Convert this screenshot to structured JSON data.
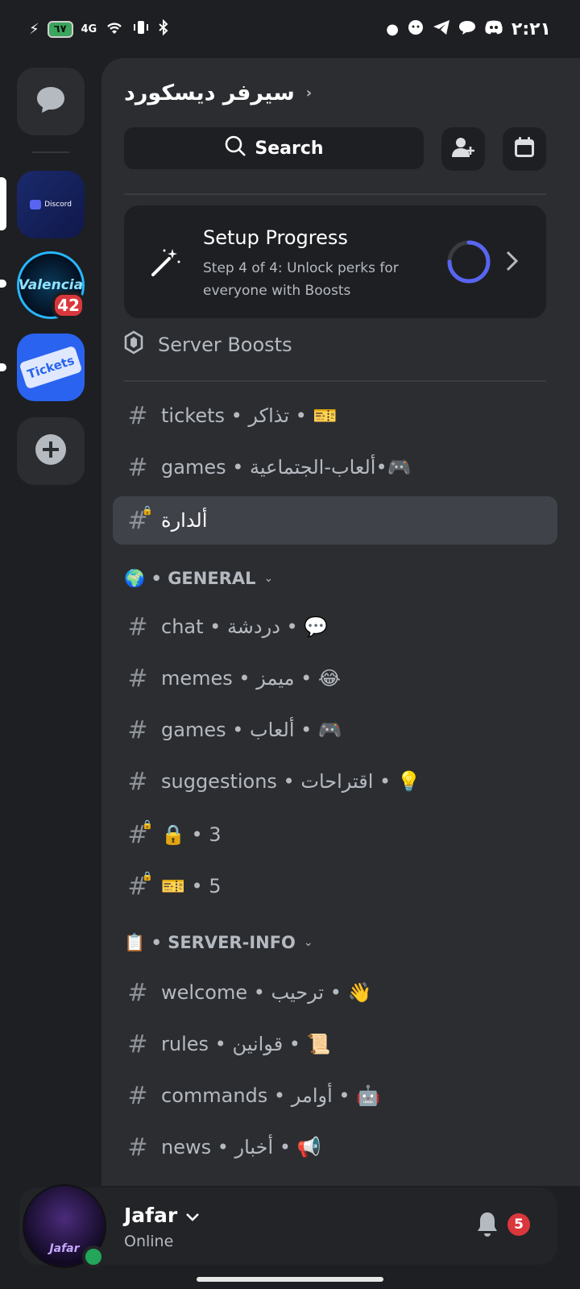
{
  "status_bar": {
    "battery": "٦٧",
    "network": "4G",
    "time": "٢:٢١"
  },
  "rail": {
    "discord_tile_label": "Discord",
    "valencia_label": "Valencia",
    "valencia_badge": "42",
    "tickets_label": "Tickets"
  },
  "header": {
    "server_name": "سيرفر ديسكورد",
    "search_label": "Search"
  },
  "setup": {
    "title": "Setup Progress",
    "subtitle": "Step 4 of 4: Unlock perks for everyone with Boosts",
    "progress": 0.75
  },
  "boosts_label": "Server Boosts",
  "channels_top": [
    {
      "name": "tickets • تذاكر • 🎫",
      "locked": false
    },
    {
      "name": "games • ألعاب-الجتماعية•🎮",
      "locked": false
    },
    {
      "name": "ألدارة",
      "locked": true,
      "active": true
    }
  ],
  "category_general": "🌍 • GENERAL",
  "channels_general": [
    {
      "name": "chat • دردشة • 💬",
      "locked": false
    },
    {
      "name": "memes • ميمز • 😂",
      "locked": false
    },
    {
      "name": "games • ألعاب • 🎮",
      "locked": false
    },
    {
      "name": "suggestions • اقتراحات • 💡",
      "locked": false
    },
    {
      "name": "🔒 • 3",
      "locked": true
    },
    {
      "name": "🎫 • 5",
      "locked": true
    }
  ],
  "category_info": "📋 • SERVER-INFO",
  "channels_info": [
    {
      "name": "welcome • ترحيب • 👋",
      "locked": false
    },
    {
      "name": "rules • قوانين • 📜",
      "locked": false
    },
    {
      "name": "commands • أوامر • 🤖",
      "locked": false
    },
    {
      "name": "news • أخبار • 📢",
      "locked": false
    }
  ],
  "user": {
    "name": "Jafar",
    "status": "Online",
    "avatar_text": "Jafar",
    "notifications": "5"
  },
  "colors": {
    "background": "#1e1f22",
    "panel": "#2b2d31",
    "accent": "#5865f2",
    "online": "#23a55a",
    "badge": "#da373c"
  }
}
